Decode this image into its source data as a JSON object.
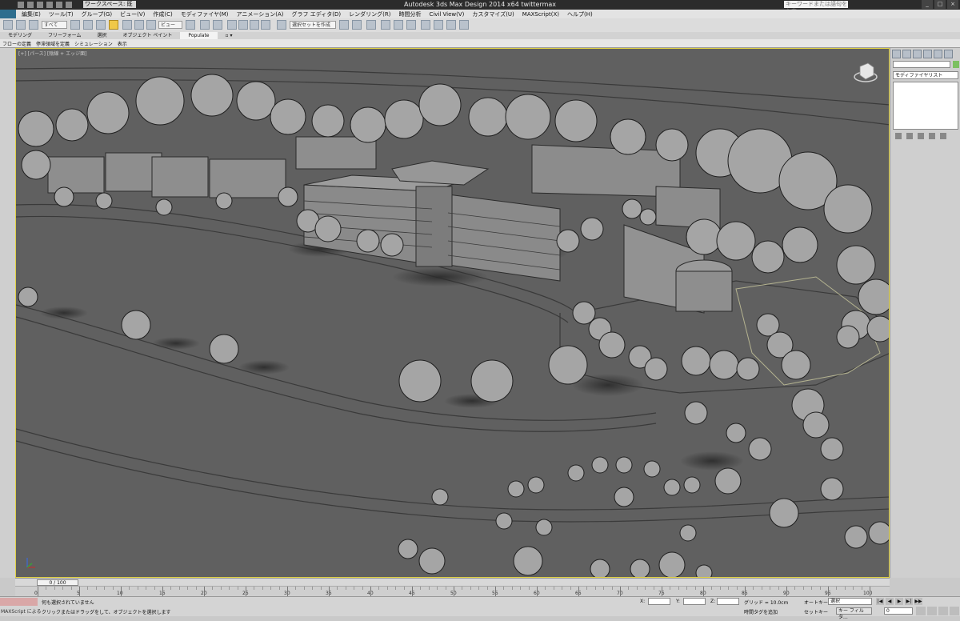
{
  "app": {
    "title": "Autodesk 3ds Max Design 2014 x64      twittermax",
    "workspace": "ワークスペース: 既定",
    "search_placeholder": "キーワードまたは語句を入力"
  },
  "menu": [
    "編集(E)",
    "ツール(T)",
    "グループ(G)",
    "ビュー(V)",
    "作成(C)",
    "モディファイヤ(M)",
    "アニメーション(A)",
    "グラフ エディタ(D)",
    "レンダリング(R)",
    "時間分析",
    "Civil View(V)",
    "カスタマイズ(U)",
    "MAXScript(X)",
    "ヘルプ(H)"
  ],
  "toolbar": {
    "selection_filter": "すべて",
    "ref_coord": "ビュー",
    "named_selection": "選択セットを作成"
  },
  "ribbon": {
    "tabs": [
      "モデリング",
      "フリーフォーム",
      "選択",
      "オブジェクト ペイント",
      "Populate"
    ],
    "active_tab": "Populate",
    "subitems": [
      "フローの定義",
      "停滞領域を定義",
      "シミュレーション",
      "表示"
    ]
  },
  "viewport": {
    "label": "[+] [パース] [陰線 + エッジ面]"
  },
  "command_panel": {
    "modifier_list": "モディファイヤリスト",
    "object_color": "#7cc061"
  },
  "timeline": {
    "slider": "0 / 100",
    "ticks": [
      "0",
      "5",
      "10",
      "15",
      "20",
      "25",
      "30",
      "35",
      "40",
      "45",
      "50",
      "55",
      "60",
      "65",
      "70",
      "75",
      "80",
      "85",
      "90",
      "95",
      "100"
    ]
  },
  "status": {
    "maxscript": "MAXScript による",
    "line1": "何も選択されていません",
    "line2": "クリックまたはドラッグをして、オブジェクトを選択します",
    "x_label": "X:",
    "y_label": "Y:",
    "z_label": "Z:",
    "grid": "グリッド = 10.0cm",
    "time_tag": "時間タグを追加",
    "auto_key": "オートキー",
    "set_key": "セットキー",
    "selection": "選択",
    "key_filter": "キー フィルタ...",
    "frame": "0"
  }
}
